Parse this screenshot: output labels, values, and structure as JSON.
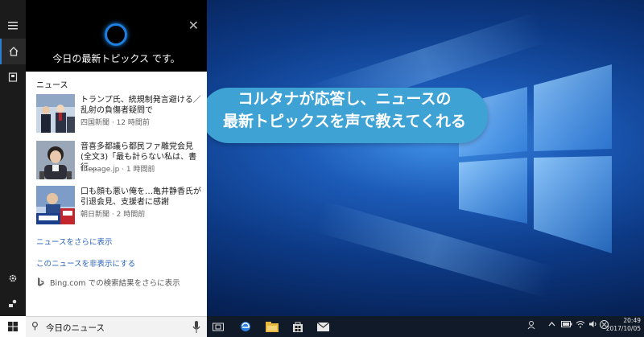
{
  "cortana": {
    "header_text": "今日の最新トピックス です。",
    "section_title": "ニュース",
    "news": [
      {
        "title": "トランプ氏、統規制発言避ける／乱射の負傷者疑問で",
        "source": "四国新聞",
        "time": "12 時間前"
      },
      {
        "title": "音喜多都議ら都民ファ離党会見(全文3)「最も計らない私は、書行…",
        "source": "thepage.jp",
        "time": "1 時間前"
      },
      {
        "title": "口も顔も悪い俺を…亀井静香氏が引退会見、支援者に感謝",
        "source": "朝日新聞",
        "time": "2 時間前"
      }
    ],
    "more_news_link": "ニュースをさらに表示",
    "hide_news_link": "このニュースを非表示にする",
    "bing_text": "Bing.com での検索結果をさらに表示",
    "search_value": "今日のニュース"
  },
  "callout": {
    "line1": "コルタナが応答し、ニュースの",
    "line2": "最新トピックスを声で教えてくれる"
  },
  "taskbar": {
    "time": "20:49",
    "date": "2017/10/05"
  },
  "colors": {
    "accent": "#1d80e0",
    "callout": "#3fa2d4",
    "link": "#2a62b8"
  }
}
